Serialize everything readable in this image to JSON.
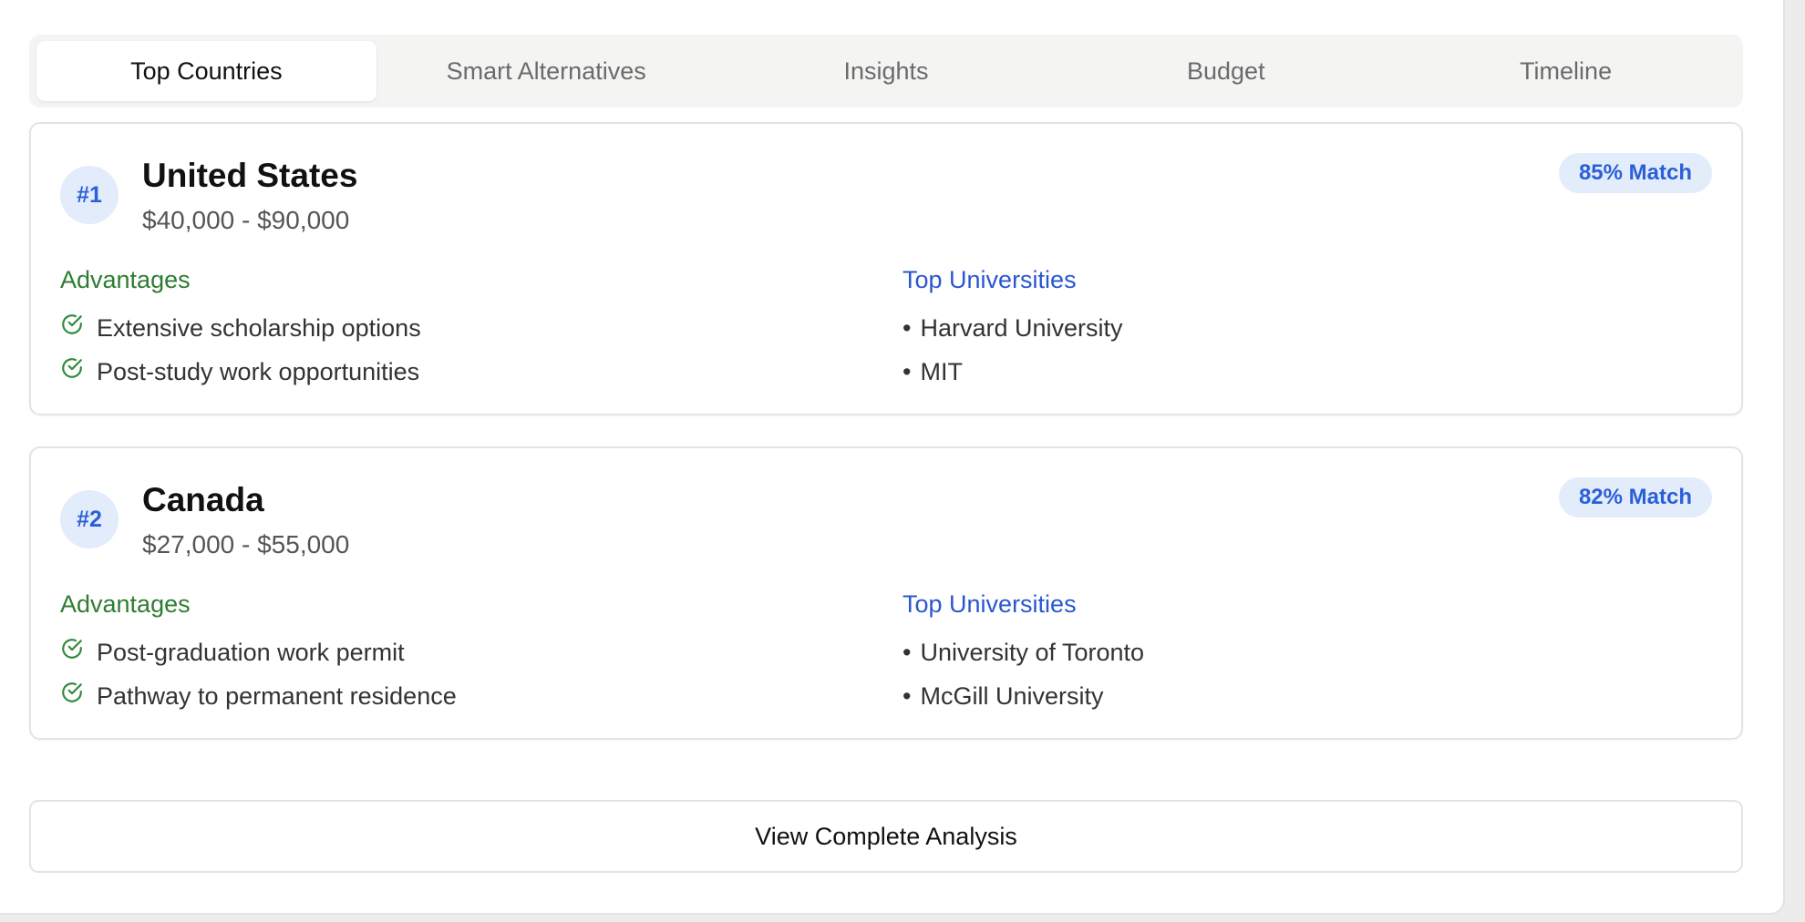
{
  "tabs": [
    {
      "label": "Top Countries",
      "active": true
    },
    {
      "label": "Smart Alternatives",
      "active": false
    },
    {
      "label": "Insights",
      "active": false
    },
    {
      "label": "Budget",
      "active": false
    },
    {
      "label": "Timeline",
      "active": false
    }
  ],
  "countries": [
    {
      "rank": "#1",
      "name": "United States",
      "cost_range": "$40,000 - $90,000",
      "match": "85% Match",
      "advantages_title": "Advantages",
      "advantages": [
        "Extensive scholarship options",
        "Post-study work opportunities"
      ],
      "universities_title": "Top Universities",
      "universities": [
        "Harvard University",
        "MIT"
      ]
    },
    {
      "rank": "#2",
      "name": "Canada",
      "cost_range": "$27,000 - $55,000",
      "match": "82% Match",
      "advantages_title": "Advantages",
      "advantages": [
        "Post-graduation work permit",
        "Pathway to permanent residence"
      ],
      "universities_title": "Top Universities",
      "universities": [
        "University of Toronto",
        "McGill University"
      ]
    }
  ],
  "bullet_char": "•",
  "icons": {
    "advantage": "check-circle-icon"
  },
  "colors": {
    "accent_blue": "#2b5fd9",
    "advantage_green": "#2f7d32",
    "badge_bg": "#e3ecfb"
  },
  "actions": {
    "view_analysis_label": "View Complete Analysis"
  }
}
